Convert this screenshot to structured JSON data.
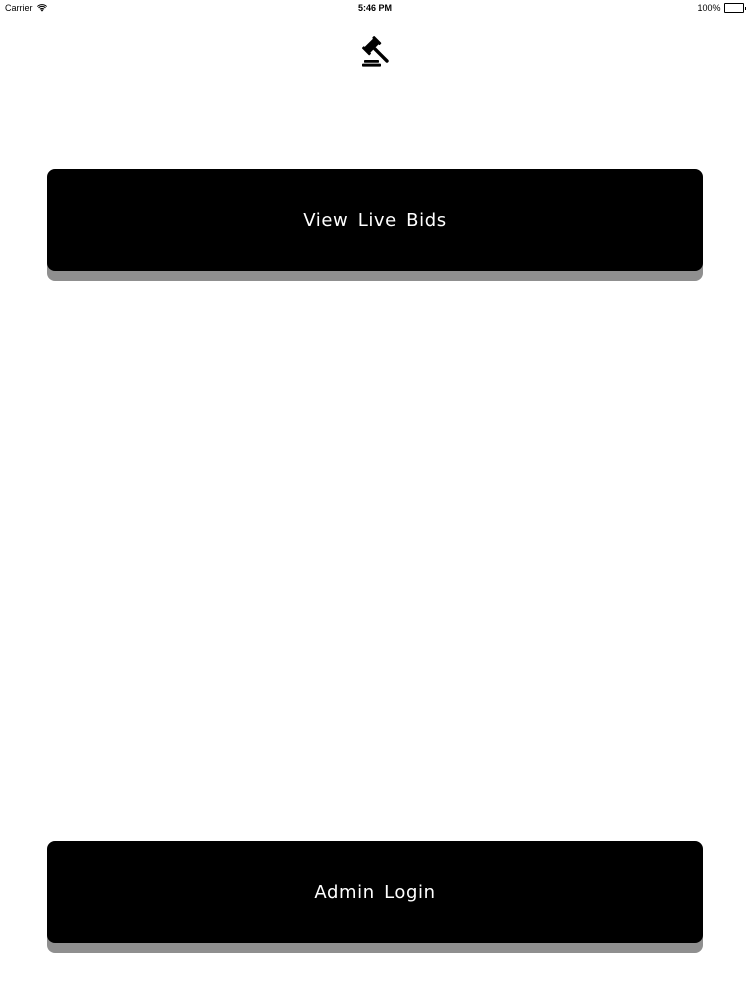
{
  "status_bar": {
    "carrier": "Carrier",
    "time": "5:46 PM",
    "battery": "100%",
    "battery_level": 1.0,
    "icons": [
      "wifi-icon",
      "battery-icon"
    ]
  },
  "logo": {
    "icon": "gavel-icon"
  },
  "buttons": {
    "live_bids": "View Live Bids",
    "admin_login": "Admin Login"
  },
  "colors": {
    "background": "#ffffff",
    "button": "#000000",
    "button_text": "#ffffff",
    "button_shadow": "#8f8f8f"
  }
}
